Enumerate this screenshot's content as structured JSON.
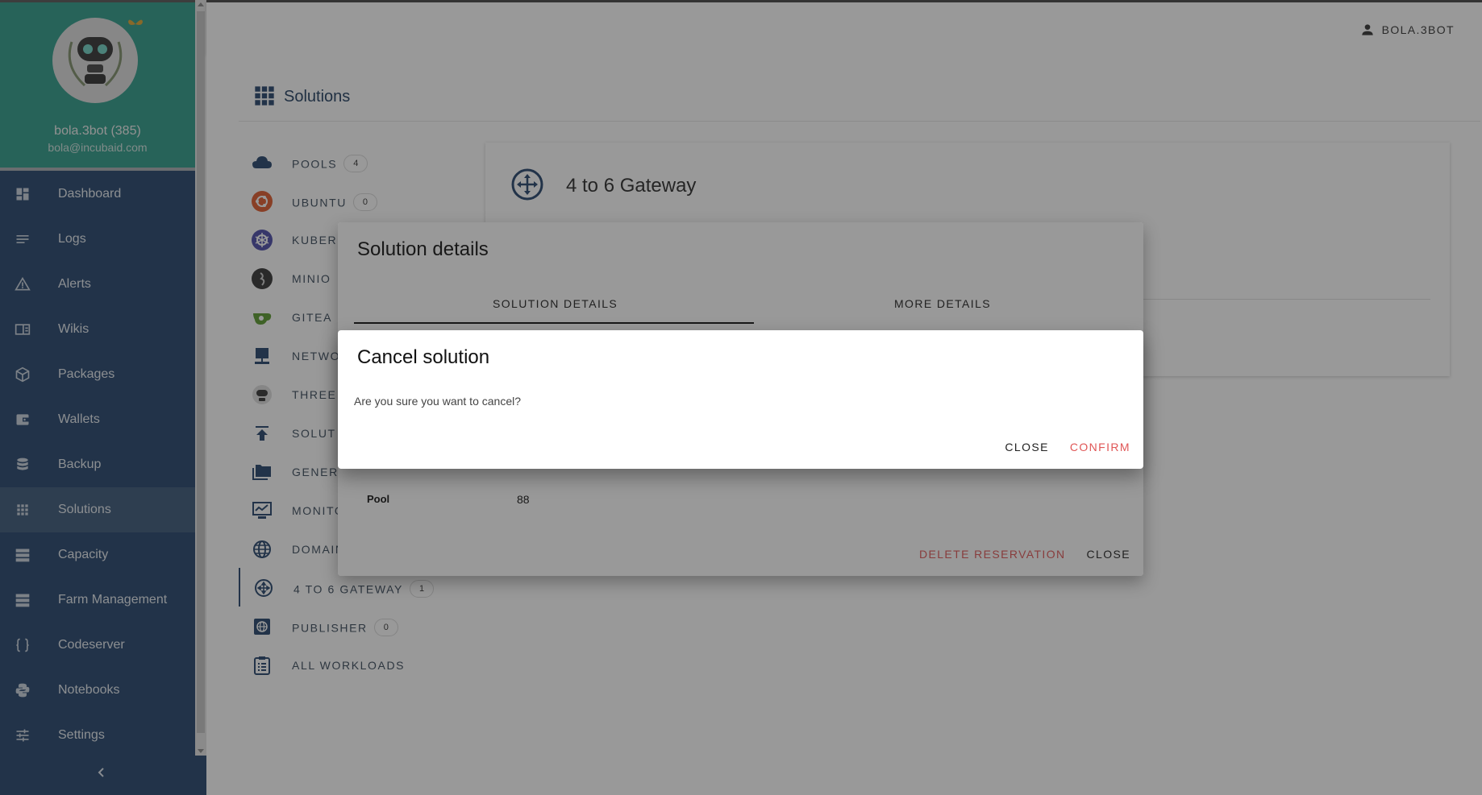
{
  "user": {
    "name": "bola.3bot (385)",
    "email": "bola@incubaid.com",
    "top_label": "BOLA.3BOT"
  },
  "sidebar": {
    "items": [
      {
        "label": "Dashboard",
        "icon": "dashboard-icon"
      },
      {
        "label": "Logs",
        "icon": "logs-icon"
      },
      {
        "label": "Alerts",
        "icon": "alert-icon"
      },
      {
        "label": "Wikis",
        "icon": "book-icon"
      },
      {
        "label": "Packages",
        "icon": "package-icon"
      },
      {
        "label": "Wallets",
        "icon": "wallet-icon"
      },
      {
        "label": "Backup",
        "icon": "database-icon"
      },
      {
        "label": "Solutions",
        "icon": "apps-icon",
        "active": true
      },
      {
        "label": "Capacity",
        "icon": "server-icon"
      },
      {
        "label": "Farm Management",
        "icon": "server-icon"
      },
      {
        "label": "Codeserver",
        "icon": "braces-icon"
      },
      {
        "label": "Notebooks",
        "icon": "python-icon"
      },
      {
        "label": "Settings",
        "icon": "tune-icon"
      }
    ]
  },
  "page": {
    "title": "Solutions"
  },
  "solutions": {
    "items": [
      {
        "label": "POOLS",
        "badge": "4"
      },
      {
        "label": "UBUNTU",
        "badge": "0"
      },
      {
        "label": "KUBER"
      },
      {
        "label": "MINIO"
      },
      {
        "label": "GITEA"
      },
      {
        "label": "NETWO"
      },
      {
        "label": "THREE"
      },
      {
        "label": "SOLUT"
      },
      {
        "label": "GENER"
      },
      {
        "label": "MONITO"
      },
      {
        "label": "DOMAIN"
      },
      {
        "label": "4 TO 6 GATEWAY",
        "badge": "1"
      },
      {
        "label": "PUBLISHER",
        "badge": "0"
      },
      {
        "label": "ALL WORKLOADS"
      }
    ]
  },
  "card": {
    "title": "4 to 6 Gateway"
  },
  "solution_dialog": {
    "title": "Solution details",
    "tabs": [
      "SOLUTION DETAILS",
      "MORE DETAILS"
    ],
    "row": {
      "label": "Pool",
      "value": "88"
    },
    "delete_label": "DELETE RESERVATION",
    "close_label": "CLOSE"
  },
  "cancel_dialog": {
    "title": "Cancel solution",
    "message": "Are you sure you want to cancel?",
    "close_label": "CLOSE",
    "confirm_label": "CONFIRM"
  },
  "colors": {
    "sidebar": "#24446b",
    "header": "#2e9c8a",
    "danger": "#e05656"
  }
}
